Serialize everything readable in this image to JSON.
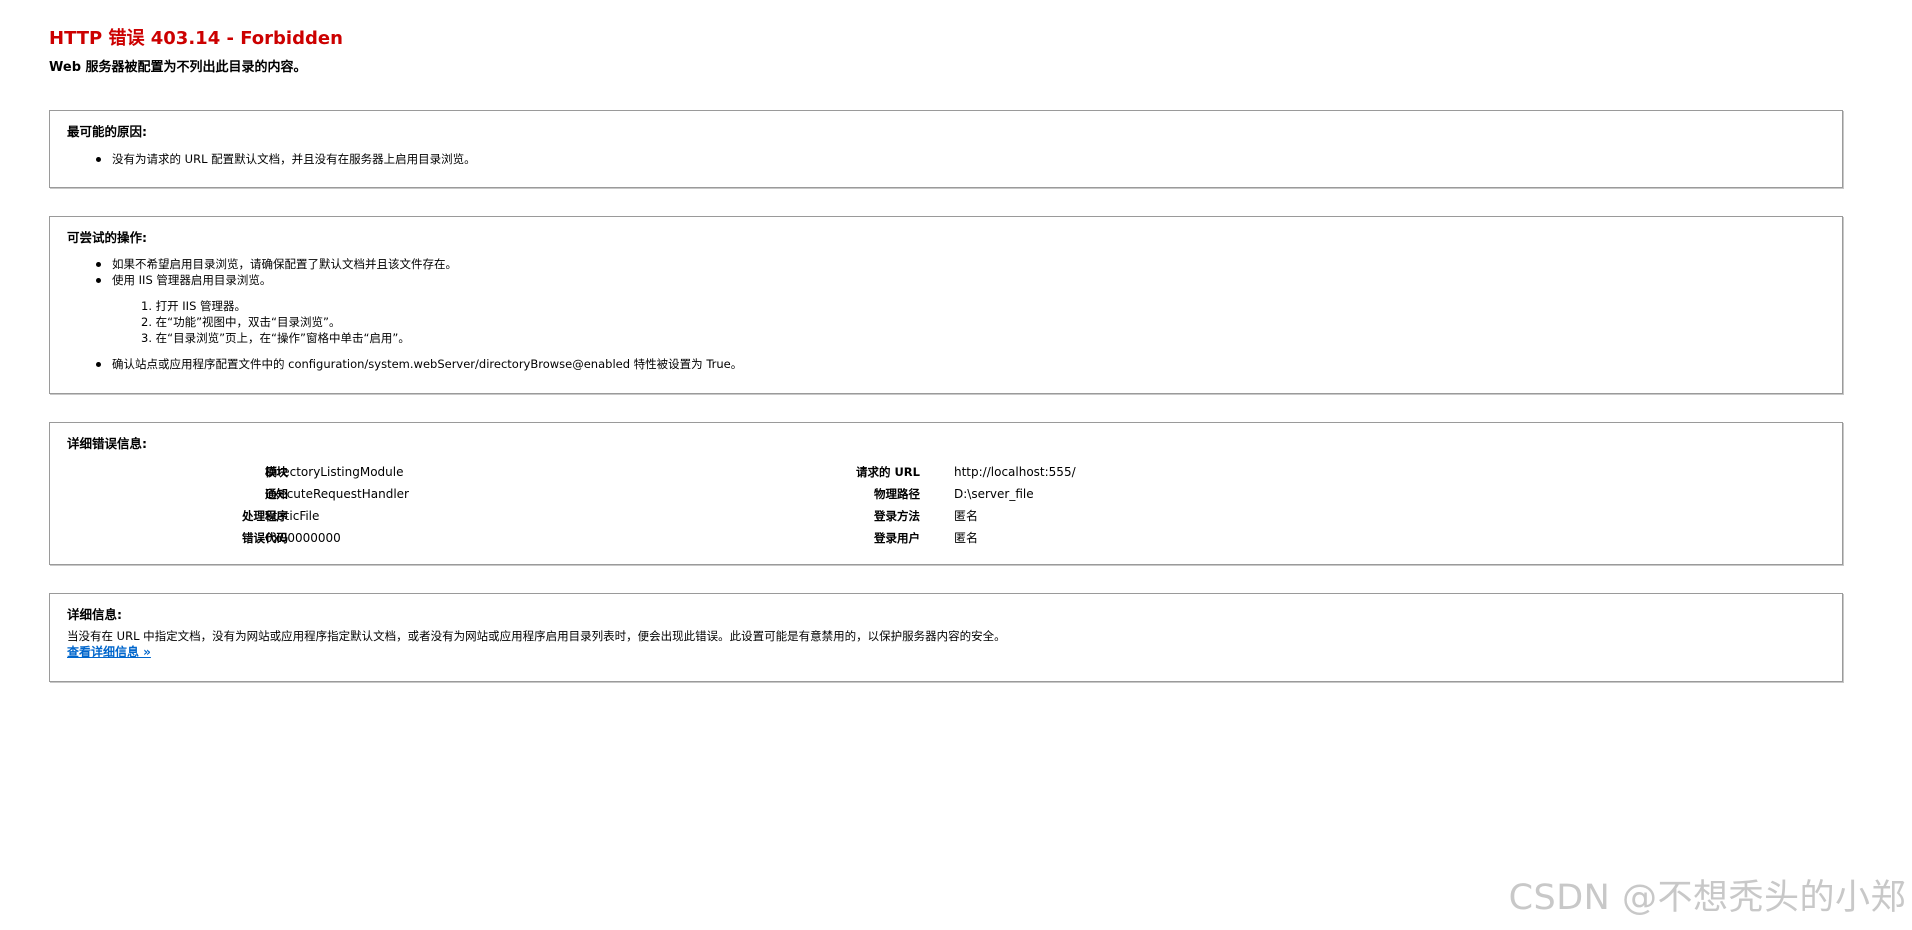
{
  "header": {
    "title": "HTTP 错误 403.14 - Forbidden",
    "subtitle": "Web 服务器被配置为不列出此目录的内容。"
  },
  "causes": {
    "heading": "最可能的原因:",
    "items": [
      "没有为请求的 URL 配置默认文档，并且没有在服务器上启用目录浏览。"
    ]
  },
  "actions": {
    "heading": "可尝试的操作:",
    "items": [
      "如果不希望启用目录浏览，请确保配置了默认文档并且该文件存在。",
      "使用 IIS 管理器启用目录浏览。"
    ],
    "steps": [
      "1. 打开 IIS 管理器。",
      "2. 在“功能”视图中，双击“目录浏览”。",
      "3. 在“目录浏览”页上，在“操作”窗格中单击“启用”。"
    ],
    "last_item": "确认站点或应用程序配置文件中的 configuration/system.webServer/directoryBrowse@enabled 特性被设置为 True。"
  },
  "error_info": {
    "heading": "详细错误信息:",
    "left": [
      {
        "label": "模块",
        "value": "DirectoryListingModule"
      },
      {
        "label": "通知",
        "value": "ExecuteRequestHandler"
      },
      {
        "label": "处理程序",
        "value": "StaticFile"
      },
      {
        "label": "错误代码",
        "value": "0x00000000"
      }
    ],
    "right": [
      {
        "label": "请求的 URL",
        "value": "http://localhost:555/"
      },
      {
        "label": "物理路径",
        "value": "D:\\server_file"
      },
      {
        "label": "登录方法",
        "value": "匿名"
      },
      {
        "label": "登录用户",
        "value": "匿名"
      }
    ]
  },
  "more_info": {
    "heading": "详细信息:",
    "text": "当没有在 URL 中指定文档，没有为网站或应用程序指定默认文档，或者没有为网站或应用程序启用目录列表时，便会出现此错误。此设置可能是有意禁用的，以保护服务器内容的安全。",
    "link": "查看详细信息 »"
  },
  "watermark": "CSDN @不想秃头的小郑",
  "colors": {
    "title": "#cc0000",
    "link": "#0066cc",
    "border": "#9a9a9a"
  }
}
